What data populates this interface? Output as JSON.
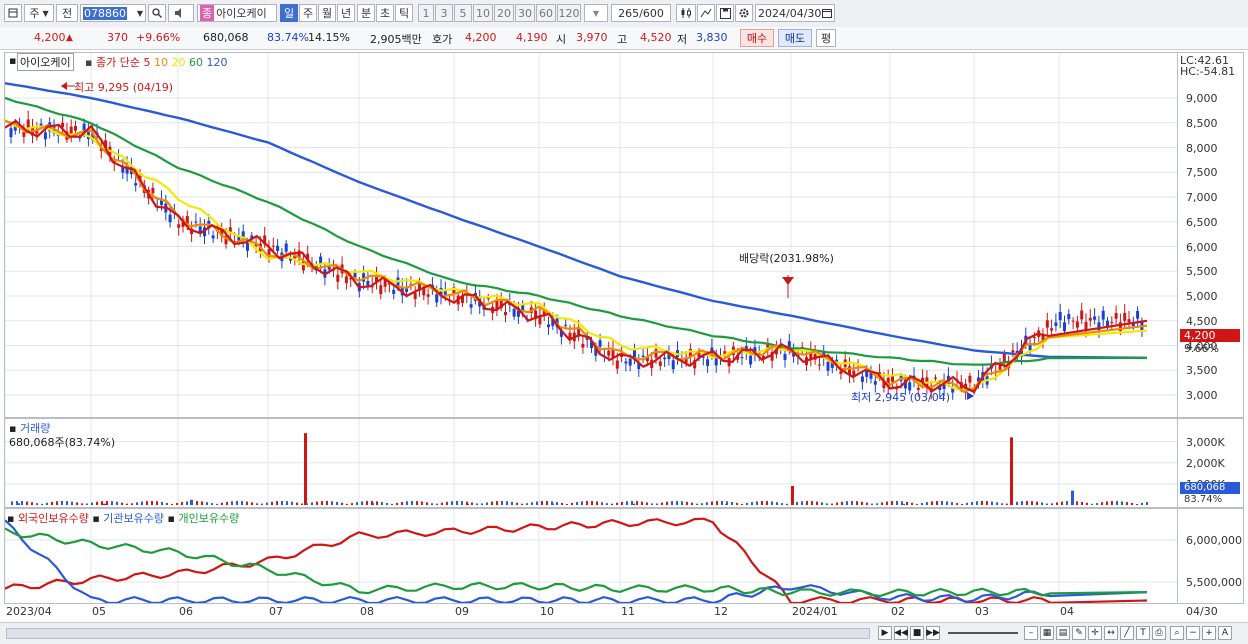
{
  "toolbar": {
    "period_label": "주",
    "prev_label": "전",
    "code": "078860",
    "type_badge": "종",
    "stock_name": "아이오케이",
    "periods": [
      "일",
      "주",
      "월",
      "년",
      "분",
      "초",
      "틱"
    ],
    "active_period": "일",
    "intervals": [
      "1",
      "3",
      "5",
      "10",
      "20",
      "30",
      "60",
      "120"
    ],
    "count": "265",
    "count_total": "/600",
    "date": "2024/04/30"
  },
  "quote": {
    "price": "4,200",
    "change": "370",
    "change_pct": "+9.66%",
    "volume": "680,068",
    "vol_ratio": "83.74%",
    "turnover": "14.15%",
    "amount": "2,905백만",
    "ask_label": "호가",
    "ask1": "4,200",
    "ask2": "4,190",
    "open_label": "시",
    "open": "3,970",
    "high_label": "고",
    "high": "4,520",
    "low_label": "저",
    "low": "3,830",
    "buy_label": "매수",
    "sell_label": "매도",
    "eval_label": "평"
  },
  "price_chart": {
    "name_tag": "아이오케이",
    "legend_prefix": "종가 단순",
    "ma_periods": [
      "5",
      "10",
      "20",
      "60",
      "120"
    ],
    "ma_colors": [
      "#d01515",
      "#f08a00",
      "#f2e800",
      "#1c9c3c",
      "#2a5ad8"
    ],
    "lc": "LC:42.61",
    "hc": "HC:-54.81",
    "y_ticks": [
      "9,000",
      "8,500",
      "8,000",
      "7,500",
      "7,000",
      "6,500",
      "6,000",
      "5,500",
      "5,000",
      "4,500",
      "4,000",
      "3,500",
      "3,000"
    ],
    "current_price": "4,200",
    "current_pct": "9.66%",
    "high_note": "최고 9,295 (04/19)",
    "low_note": "최저 2,945 (03/04)",
    "dividend_note": "배당락(2031.98%)"
  },
  "volume_chart": {
    "title": "거래량",
    "value_label": "680,068주(83.74%)",
    "y_ticks": [
      "3,000K",
      "2,000K",
      "1,000K"
    ],
    "current": "680,068",
    "current_pct": "83.74%"
  },
  "holding_chart": {
    "legends": [
      "외국인보유수량",
      "기관보유수량",
      "개인보유수량"
    ],
    "legend_colors": [
      "#d01515",
      "#2a5ad8",
      "#1c9c3c"
    ],
    "y_ticks": [
      "6,000,000",
      "5,500,000"
    ]
  },
  "x_labels": [
    "2023/04",
    "05",
    "06",
    "07",
    "08",
    "09",
    "10",
    "11",
    "12",
    "2024/01",
    "02",
    "03",
    "04"
  ],
  "x_axis_end": "04/30",
  "chart_data": [
    {
      "type": "line",
      "title": "",
      "x": [
        "2023/04",
        "05",
        "06",
        "07",
        "08",
        "09",
        "10",
        "11",
        "12",
        "2024/01",
        "02",
        "03",
        "04"
      ],
      "ylim": [
        2800,
        9300
      ],
      "series": [
        {
          "name": "5",
          "values": [
            8400,
            8300,
            6500,
            6000,
            5300,
            5000,
            4600,
            3700,
            3750,
            3900,
            3250,
            3200,
            4500
          ]
        },
        {
          "name": "10",
          "values": [
            8450,
            8250,
            6600,
            5900,
            5400,
            5050,
            4700,
            3800,
            3800,
            3950,
            3300,
            3150,
            4400
          ]
        },
        {
          "name": "20",
          "values": [
            8500,
            8200,
            7000,
            5800,
            5500,
            5100,
            4800,
            4000,
            3800,
            3950,
            3400,
            3100,
            4300
          ]
        },
        {
          "name": "60",
          "values": [
            9000,
            8500,
            7600,
            6900,
            6000,
            5300,
            5000,
            4600,
            4200,
            3950,
            3750,
            3600,
            3750
          ]
        },
        {
          "name": "120",
          "values": [
            9300,
            9000,
            8600,
            8100,
            7300,
            6600,
            6000,
            5400,
            4900,
            4600,
            4200,
            3900,
            3750
          ]
        }
      ],
      "annotations": [
        "최고 9,295 (04/19)",
        "최저 2,945 (03/04)",
        "배당락(2031.98%)"
      ]
    },
    {
      "type": "bar",
      "title": "거래량",
      "categories": [
        "2023/04",
        "05",
        "06",
        "07",
        "08",
        "09",
        "10",
        "11",
        "12",
        "2024/01",
        "02",
        "03",
        "04"
      ],
      "values": [
        80,
        60,
        250,
        3400,
        90,
        60,
        70,
        60,
        40,
        900,
        50,
        3200,
        680
      ],
      "ylabel": "K",
      "ylim": [
        0,
        3500
      ]
    },
    {
      "type": "line",
      "title": "",
      "x": [
        "2023/04",
        "05",
        "06",
        "07",
        "08",
        "09",
        "10",
        "11",
        "12",
        "2024/01",
        "02",
        "03",
        "04"
      ],
      "series": [
        {
          "name": "외국인보유수량",
          "values": [
            5420000,
            5530000,
            5600000,
            5750000,
            6050000,
            6100000,
            6150000,
            6200000,
            6220000,
            5280000,
            5280000,
            5280000,
            5280000
          ]
        },
        {
          "name": "기관보유수량",
          "values": [
            6200000,
            5280000,
            5280000,
            5280000,
            5280000,
            5280000,
            5280000,
            5280000,
            5280000,
            5450000,
            5320000,
            5300000,
            5380000
          ]
        },
        {
          "name": "개인보유수량",
          "values": [
            6100000,
            5950000,
            5850000,
            5650000,
            5400000,
            5450000,
            5450000,
            5420000,
            5420000,
            5380000,
            5370000,
            5380000,
            5380000
          ]
        }
      ],
      "ylim": [
        5250000,
        6200000
      ]
    }
  ]
}
